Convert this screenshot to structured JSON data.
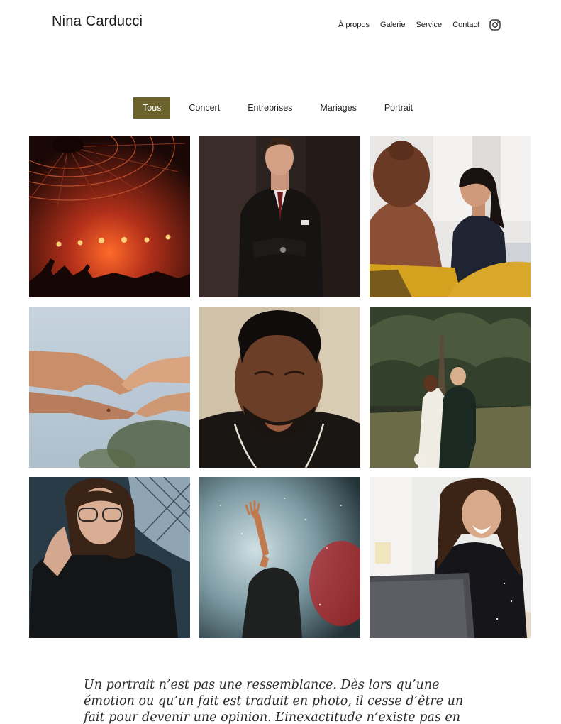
{
  "site": {
    "brand": "Nina Carducci"
  },
  "nav": {
    "items": [
      "À propos",
      "Galerie",
      "Service",
      "Contact"
    ],
    "instagram_icon": "instagram-icon"
  },
  "filters": {
    "items": [
      "Tous",
      "Concert",
      "Entreprises",
      "Mariages",
      "Portrait"
    ],
    "active": "Tous",
    "active_color": "#6b632b"
  },
  "gallery": {
    "photos": [
      {
        "category": "Concert",
        "subject": "concert-stage"
      },
      {
        "category": "Entreprises",
        "subject": "man-in-suit"
      },
      {
        "category": "Entreprises",
        "subject": "business-meeting"
      },
      {
        "category": "Mariages",
        "subject": "hands-reaching"
      },
      {
        "category": "Portrait",
        "subject": "man-portrait"
      },
      {
        "category": "Mariages",
        "subject": "wedding-couple"
      },
      {
        "category": "Portrait",
        "subject": "woman-glasses"
      },
      {
        "category": "Concert",
        "subject": "concert-crowd"
      },
      {
        "category": "Entreprises",
        "subject": "woman-laptop"
      }
    ]
  },
  "about": {
    "quote": "Un portrait n’est pas une ressemblance. Dès lors qu’une émotion ou qu’un fait est traduit en photo, il cesse d’être un fait pour devenir une opinion. L’inexactitude n’existe pas en photographie. Toutes les"
  }
}
